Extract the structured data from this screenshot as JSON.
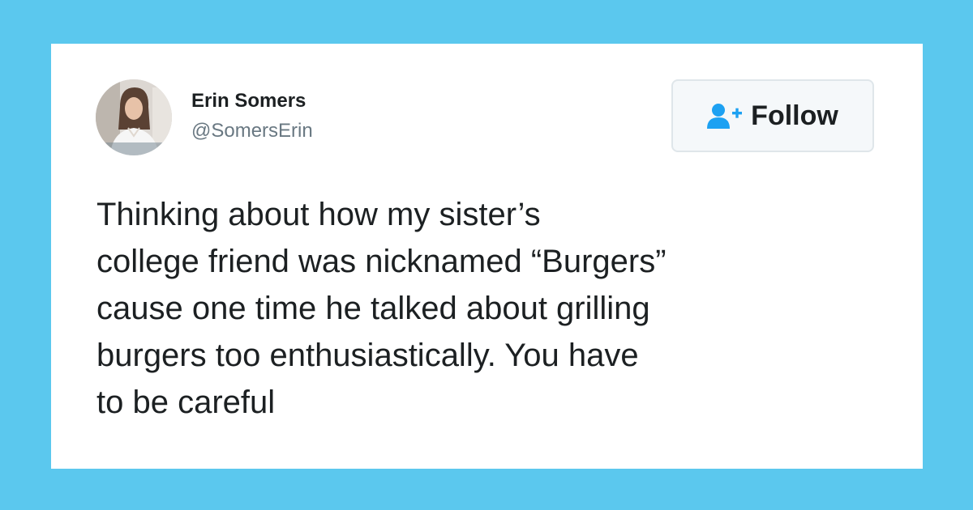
{
  "author": {
    "name": "Erin Somers",
    "handle": "@SomersErin",
    "avatar_icon": "profile-photo"
  },
  "follow_button": {
    "label": "Follow",
    "icon": "add-user-icon",
    "icon_color": "#1da1f2"
  },
  "tweet": {
    "lines": [
      "Thinking about how my sister’s",
      "college friend was nicknamed “Burgers”",
      "cause one time he talked about grilling",
      "burgers too enthusiastically. You have",
      "to be careful"
    ]
  },
  "colors": {
    "background": "#5bc8ee",
    "card": "#ffffff",
    "text": "#1c2022",
    "handle": "#697882"
  }
}
